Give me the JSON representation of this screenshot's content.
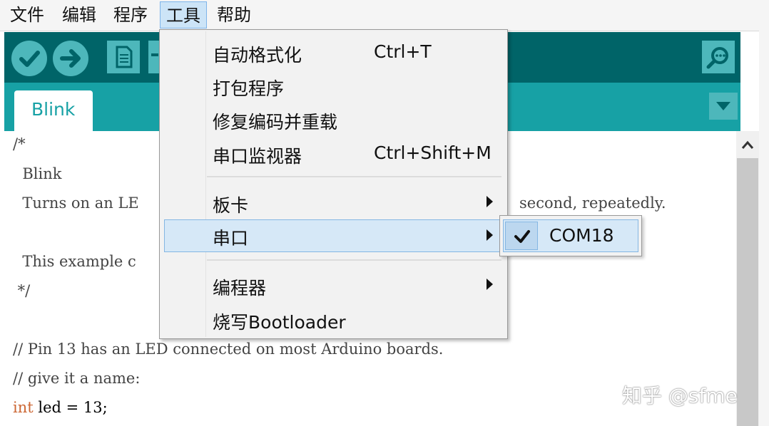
{
  "menubar": {
    "items": [
      {
        "label": "文件"
      },
      {
        "label": "编辑"
      },
      {
        "label": "程序"
      },
      {
        "label": "工具"
      },
      {
        "label": "帮助"
      }
    ]
  },
  "toolbar": {
    "buttons": [
      "verify-icon",
      "upload-icon",
      "new-icon",
      "open-icon",
      "serial-monitor-icon"
    ]
  },
  "tabs": {
    "active": "Blink"
  },
  "editor": {
    "lines": [
      "/*",
      "  Blink",
      "  Turns on an LE",
      "  This example c",
      " */",
      "// Pin 13 has an LED connected on most Arduino boards.",
      "// give it a name:"
    ],
    "tail_right": "second, repeatedly.",
    "last_line": {
      "keyword": "int",
      "rest": " led = 13;"
    }
  },
  "tools_menu": {
    "items": [
      {
        "label": "自动格式化",
        "shortcut": "Ctrl+T"
      },
      {
        "label": "打包程序"
      },
      {
        "label": "修复编码并重载"
      },
      {
        "label": "串口监视器",
        "shortcut": "Ctrl+Shift+M"
      },
      {
        "label": "板卡",
        "submenu": true
      },
      {
        "label": "串口",
        "submenu": true,
        "highlighted": true
      },
      {
        "label": "编程器",
        "submenu": true
      },
      {
        "label": "烧写Bootloader"
      }
    ]
  },
  "port_submenu": {
    "items": [
      {
        "label": "COM18",
        "checked": true
      }
    ]
  },
  "watermark": "知乎 @sfme",
  "colors": {
    "toolbar_bg": "#006468",
    "tab_strip_bg": "#17a1a5",
    "button_bg": "#4db7bb",
    "menu_highlight": "#d6e8f7",
    "keyword": "#cc6633"
  }
}
